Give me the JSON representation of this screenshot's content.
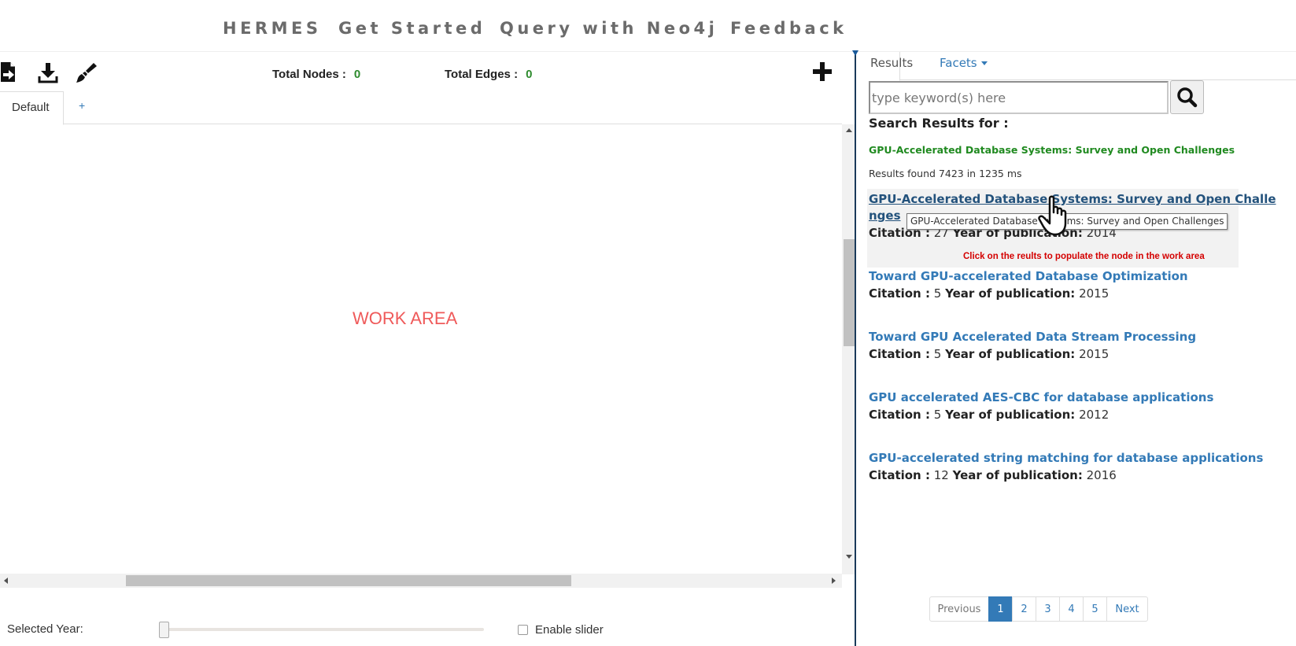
{
  "nav": {
    "items": [
      "HERMES",
      "Get Started",
      "Query with Neo4j",
      "Feedback"
    ]
  },
  "toolbar": {
    "icons": [
      "import-file-icon",
      "download-icon",
      "brush-icon"
    ]
  },
  "stats": {
    "nodes_label": "Total Nodes :",
    "nodes_value": "0",
    "edges_label": "Total Edges :",
    "edges_value": "0"
  },
  "work_tabs": {
    "default_label": "Default",
    "add_label": "+"
  },
  "work_area": {
    "label": "WORK AREA"
  },
  "timeline": {
    "selected_year_label": "Selected Year:",
    "enable_slider_label": "Enable slider",
    "enabled": false
  },
  "right_tabs": {
    "results": "Results",
    "facets": "Facets"
  },
  "search": {
    "placeholder": "type keyword(s) here",
    "value": ""
  },
  "search_results": {
    "label": "Search Results for :",
    "query": "GPU-Accelerated Database Systems: Survey and Open Challenges",
    "count_text": "Results found 7423 in 1235 ms"
  },
  "results": [
    {
      "title_line1": "GPU-Accelerated Database Systems: Survey and Open Challe",
      "title_line2": "nges",
      "citation_label": "Citation :",
      "citation": "27",
      "year_label": "Year of publication:",
      "year": "2014"
    },
    {
      "title": "Toward GPU-accelerated Database Optimization",
      "citation_label": "Citation :",
      "citation": "5",
      "year_label": "Year of publication:",
      "year": "2015"
    },
    {
      "title": "Toward GPU Accelerated Data Stream Processing",
      "citation_label": "Citation :",
      "citation": "5",
      "year_label": "Year of publication:",
      "year": "2015"
    },
    {
      "title": "GPU accelerated AES-CBC for database applications",
      "citation_label": "Citation :",
      "citation": "5",
      "year_label": "Year of publication:",
      "year": "2012"
    },
    {
      "title": "GPU-accelerated string matching for database applications",
      "citation_label": "Citation :",
      "citation": "12",
      "year_label": "Year of publication:",
      "year": "2016"
    }
  ],
  "tooltip": {
    "text": "GPU-Accelerated Database Systems: Survey and Open Challenges"
  },
  "hint": {
    "text": "Click on the reults to populate the node in the work area"
  },
  "pagination": {
    "previous": "Previous",
    "pages": [
      "1",
      "2",
      "3",
      "4",
      "5"
    ],
    "next": "Next",
    "active": "1"
  },
  "colors": {
    "link": "#337ab7",
    "query": "#208a20",
    "count": "#2e8b2e",
    "work_area_label": "#ef5a5a",
    "hint": "#d40000"
  }
}
